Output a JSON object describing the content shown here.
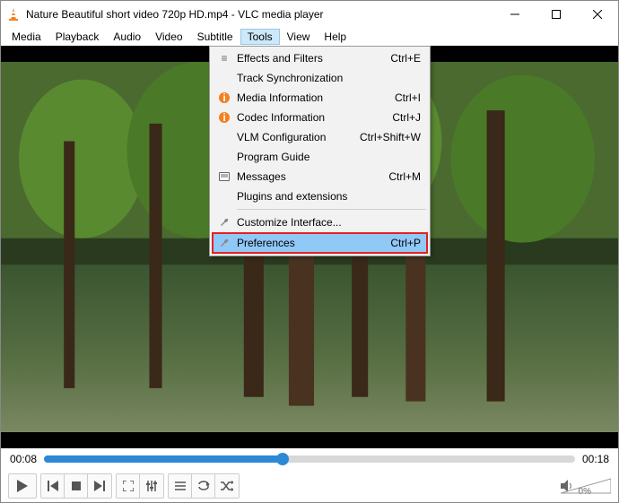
{
  "titlebar": {
    "title": "Nature Beautiful short video 720p HD.mp4 - VLC media player"
  },
  "menubar": {
    "items": [
      "Media",
      "Playback",
      "Audio",
      "Video",
      "Subtitle",
      "Tools",
      "View",
      "Help"
    ],
    "active_index": 5
  },
  "tools_menu": {
    "items": [
      {
        "label": "Effects and Filters",
        "shortcut": "Ctrl+E",
        "icon": "sliders"
      },
      {
        "label": "Track Synchronization",
        "shortcut": "",
        "icon": ""
      },
      {
        "label": "Media Information",
        "shortcut": "Ctrl+I",
        "icon": "info"
      },
      {
        "label": "Codec Information",
        "shortcut": "Ctrl+J",
        "icon": "info"
      },
      {
        "label": "VLM Configuration",
        "shortcut": "Ctrl+Shift+W",
        "icon": ""
      },
      {
        "label": "Program Guide",
        "shortcut": "",
        "icon": ""
      },
      {
        "label": "Messages",
        "shortcut": "Ctrl+M",
        "icon": "messages"
      },
      {
        "label": "Plugins and extensions",
        "shortcut": "",
        "icon": ""
      }
    ],
    "items2": [
      {
        "label": "Customize Interface...",
        "shortcut": "",
        "icon": "wrench"
      },
      {
        "label": "Preferences",
        "shortcut": "Ctrl+P",
        "icon": "wrench",
        "highlighted": true
      }
    ]
  },
  "playback": {
    "current_time": "00:08",
    "total_time": "00:18",
    "progress_percent": 45
  },
  "volume": {
    "percent_label": "0%"
  }
}
